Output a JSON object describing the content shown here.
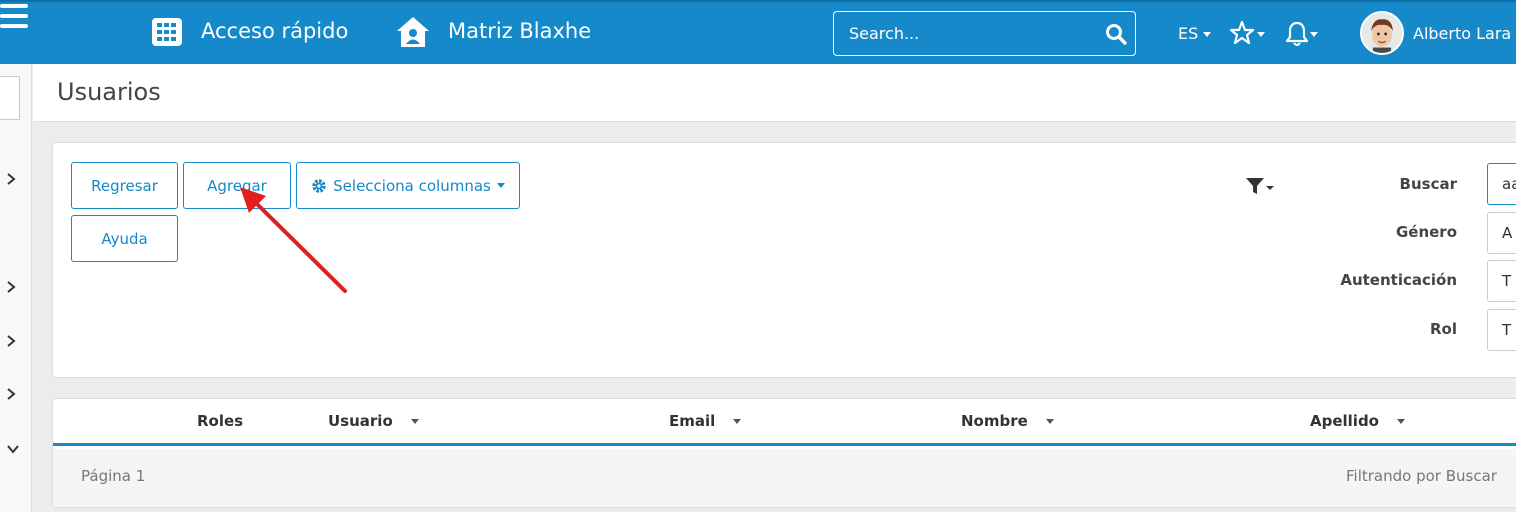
{
  "topbar": {
    "quick_access": "Acceso rápido",
    "company": "Matriz Blaxhe",
    "search_placeholder": "Search...",
    "language": "ES",
    "user_name": "Alberto Lara T"
  },
  "page": {
    "title": "Usuarios"
  },
  "toolbar": {
    "back_label": "Regresar",
    "add_label": "Agregar",
    "columns_label": "Selecciona columnas",
    "help_label": "Ayuda"
  },
  "filters": {
    "search_label": "Buscar",
    "search_value": "aa",
    "gender_label": "Género",
    "gender_value": "A",
    "auth_label": "Autenticación",
    "auth_value": "T",
    "role_label": "Rol",
    "role_value": "T"
  },
  "table": {
    "columns": [
      "Roles",
      "Usuario",
      "Email",
      "Nombre",
      "Apellido"
    ],
    "page_label": "Página 1",
    "filter_status": "Filtrando por Buscar"
  },
  "colors": {
    "brand": "#1589c9",
    "annotation_arrow": "#e02020"
  },
  "icons": [
    "menu-icon",
    "grid-icon",
    "home-icon",
    "search-icon",
    "star-icon",
    "bell-icon",
    "gear-icon",
    "filter-icon",
    "chevron-right-icon",
    "chevron-down-icon",
    "caret-down-icon"
  ]
}
